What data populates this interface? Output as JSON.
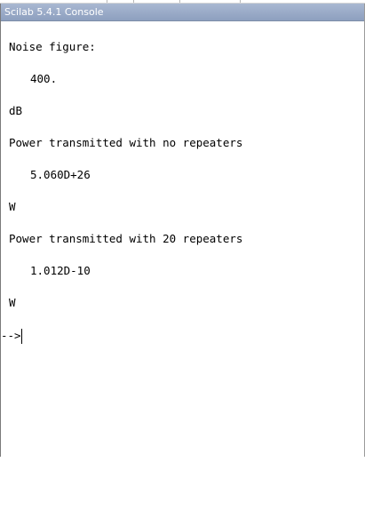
{
  "window": {
    "title": "Scilab 5.4.1 Console"
  },
  "console": {
    "lines": [
      "Noise figure:",
      "400.",
      "dB",
      "Power transmitted with no repeaters",
      "5.060D+26",
      "W",
      "Power transmitted with 20 repeaters",
      "1.012D-10",
      "W"
    ],
    "prompt": "-->"
  }
}
